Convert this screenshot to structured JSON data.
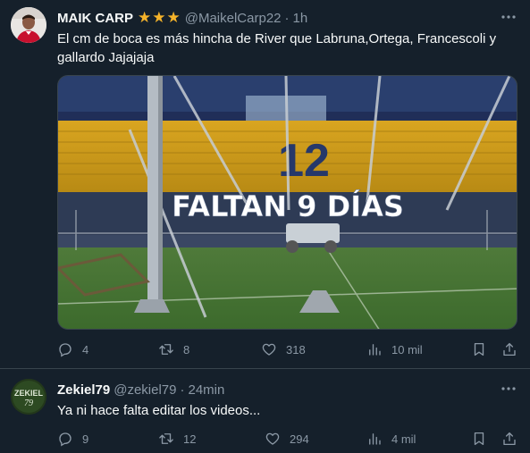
{
  "tweets": [
    {
      "name": "MAIK CARP",
      "stars": "★★★",
      "handle": "@MaikelCarp22",
      "time": "1h",
      "text": "El cm de boca es más hincha de River que Labruna,Ortega, Francescoli y gallardo Jajajaja",
      "media": {
        "overlay_text": "FALTAN 9 DÍAS",
        "seat_number": "12"
      },
      "actions": {
        "replies": "4",
        "reposts": "8",
        "likes": "318",
        "views": "10 mil"
      }
    },
    {
      "name": "Zekiel79",
      "avatar_text": "ZEKIEL 79",
      "handle": "@zekiel79",
      "time": "24min",
      "text": "Ya ni hace falta editar los videos...",
      "actions": {
        "replies": "9",
        "reposts": "12",
        "likes": "294",
        "views": "4 mil"
      }
    }
  ],
  "icons": {
    "reply": "reply-icon",
    "repost": "repost-icon",
    "like": "heart-icon",
    "views": "views-icon",
    "bookmark": "bookmark-icon",
    "share": "share-icon",
    "more": "more-icon"
  },
  "colors": {
    "background": "#15202b",
    "primary_text": "#f7f9f9",
    "secondary_text": "#8b98a5",
    "divider": "#38444d",
    "stars": "#f5b32a"
  }
}
